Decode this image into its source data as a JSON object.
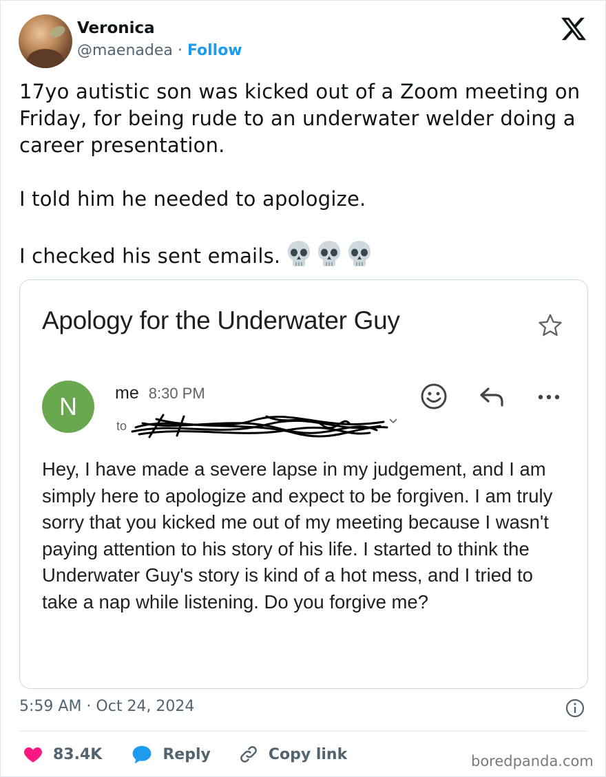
{
  "header": {
    "display_name": "Veronica",
    "handle": "@maenadea",
    "separator": "·",
    "follow_label": "Follow",
    "logo_icon": "x-logo-icon"
  },
  "tweet": {
    "text": "17yo autistic son was kicked out of a Zoom meeting on Friday, for being rude to an underwater welder doing a career presentation.\n\nI told him he needed to apologize.\n\nI checked his sent emails.",
    "emojis": [
      "skull",
      "skull",
      "skull"
    ]
  },
  "email": {
    "subject": "Apology for the Underwater Guy",
    "sender_initial": "N",
    "sender_name": "me",
    "sent_time": "8:30 PM",
    "to_prefix": "to",
    "body": "Hey, I have made a severe lapse in my judgement, and I am simply here to apologize and expect to be forgiven. I am truly sorry that you kicked me out of my meeting because I wasn't paying attention to his story of his life. I started to think the Underwater Guy's story is kind of a hot mess, and I tried to take a nap while listening. Do you forgive me?",
    "avatar_color": "#6aa84f"
  },
  "meta": {
    "timestamp": "5:59 AM · Oct 24, 2024"
  },
  "actions": {
    "likes": "83.4K",
    "reply_label": "Reply",
    "copy_label": "Copy link"
  },
  "watermark": "boredpanda.com",
  "colors": {
    "accent": "#1d9bf0",
    "heart": "#f91880",
    "text": "#0f1419",
    "muted": "#536471"
  }
}
